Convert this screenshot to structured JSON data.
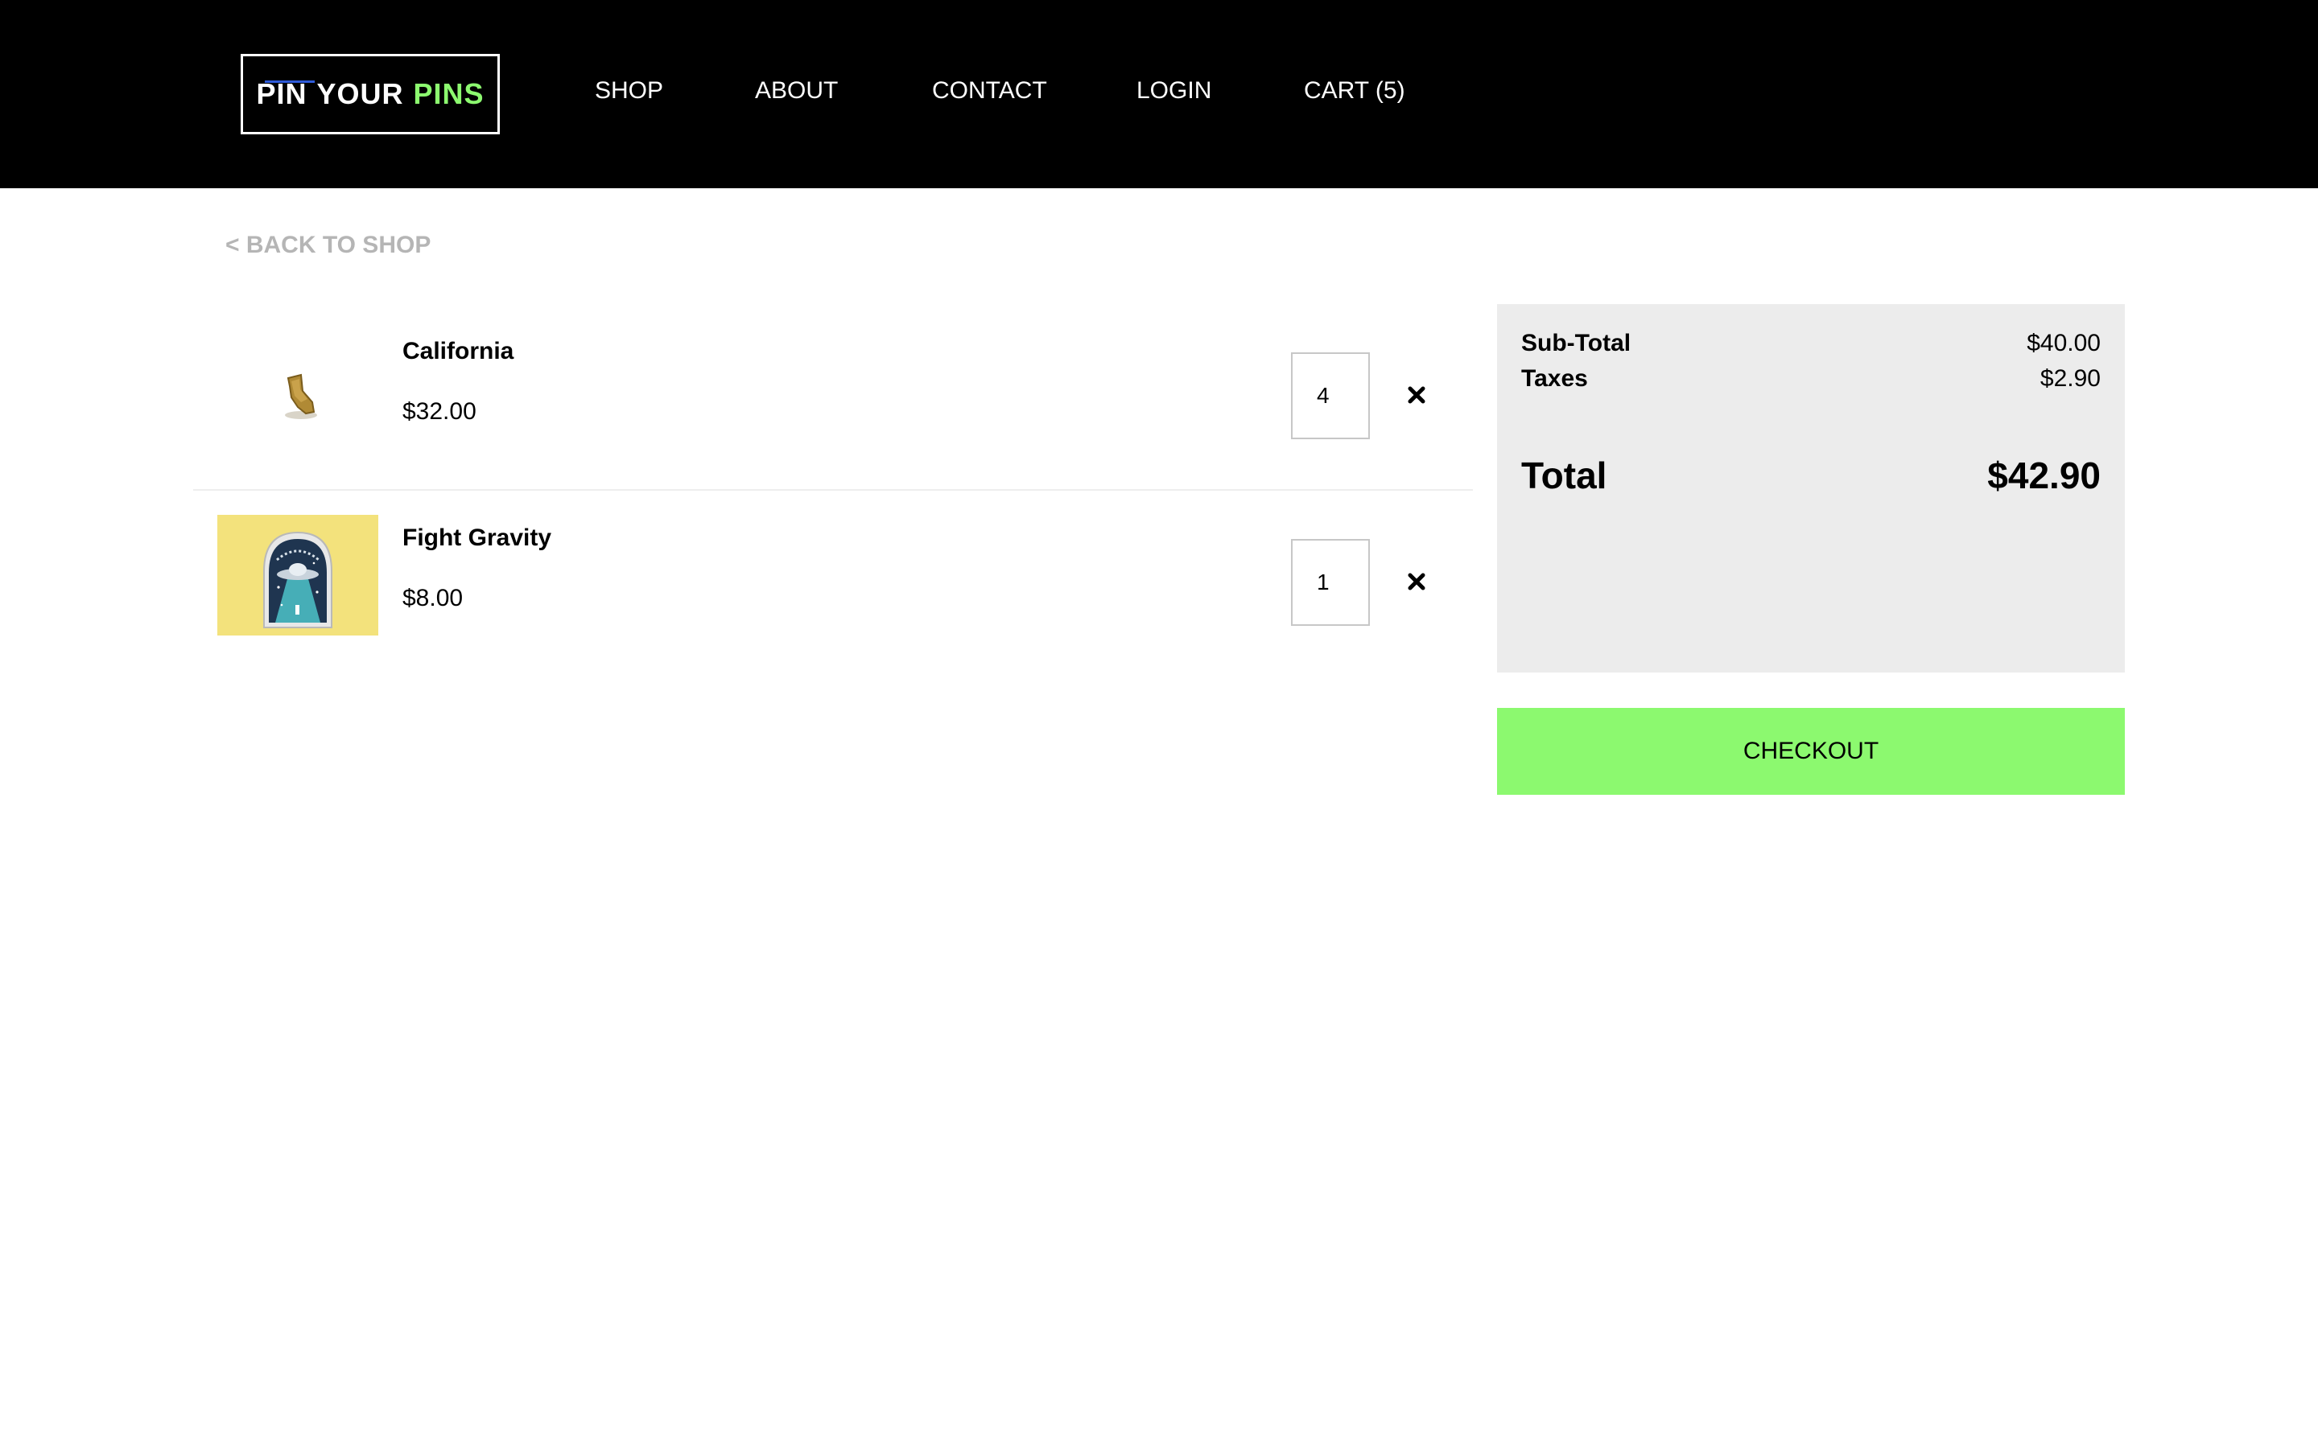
{
  "brand": {
    "logo_words": [
      "PIN",
      "YOUR",
      "PINS"
    ],
    "accent_color": "#8cf96f",
    "logo_line_color": "#2f5bd9"
  },
  "nav": {
    "items": [
      {
        "label": "SHOP"
      },
      {
        "label": "ABOUT"
      },
      {
        "label": "CONTACT"
      },
      {
        "label": "LOGIN"
      },
      {
        "label": "CART (5)"
      }
    ]
  },
  "back_link": {
    "label": "< BACK TO SHOP"
  },
  "cart": {
    "items": [
      {
        "name": "California",
        "price": "$32.00",
        "quantity": "4",
        "image_icon": "california-pin-image",
        "remove_icon": "close-icon"
      },
      {
        "name": "Fight Gravity",
        "price": "$8.00",
        "quantity": "1",
        "image_icon": "fight-gravity-pin-image",
        "remove_icon": "close-icon"
      }
    ]
  },
  "summary": {
    "subtotal_label": "Sub-Total",
    "subtotal_value": "$40.00",
    "taxes_label": "Taxes",
    "taxes_value": "$2.90",
    "total_label": "Total",
    "total_value": "$42.90"
  },
  "checkout": {
    "label": "CHECKOUT",
    "color": "#8cf96f"
  }
}
